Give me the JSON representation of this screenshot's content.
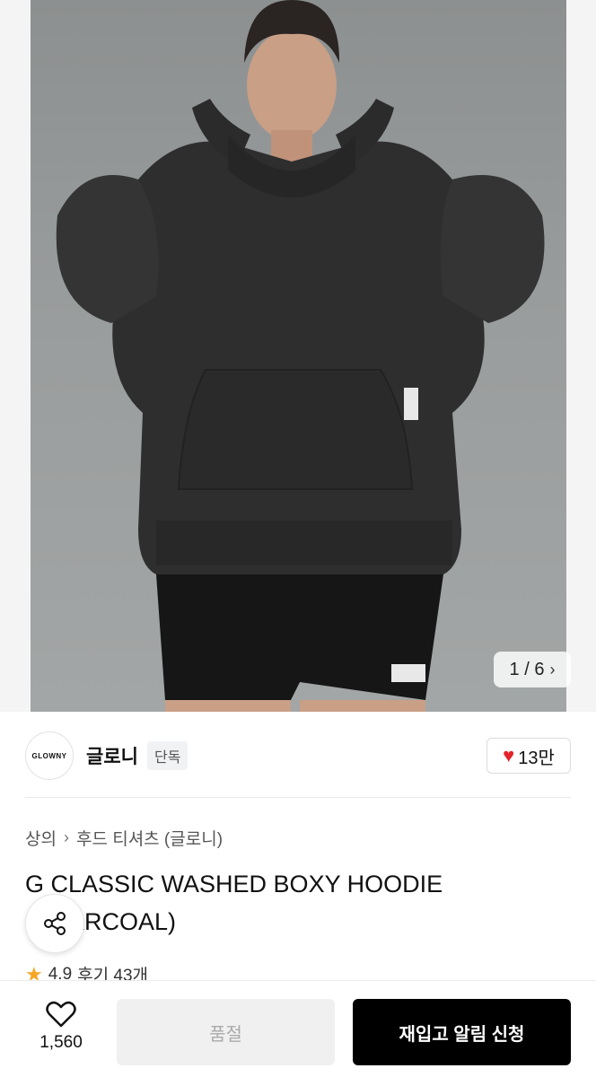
{
  "gallery": {
    "counter": "1 / 6",
    "next_icon": "chevron-right-icon"
  },
  "brand": {
    "logo_text": "GLOWNY",
    "name": "글로니",
    "badge": "단독",
    "like_count": "13만"
  },
  "breadcrumb": {
    "category": "상의",
    "subcategory": "후드 티셔츠 (글로니)"
  },
  "product": {
    "title": "G CLASSIC WASHED BOXY HOODIE (CHARCOAL)"
  },
  "rating": {
    "score": "4.9",
    "reviews": "후기 43개"
  },
  "bottom": {
    "wish_count": "1,560",
    "soldout_label": "품절",
    "restock_label": "재입고 알림 신청"
  },
  "colors": {
    "accent": "#000000",
    "heart": "#e3242b",
    "star": "#f5a623"
  }
}
